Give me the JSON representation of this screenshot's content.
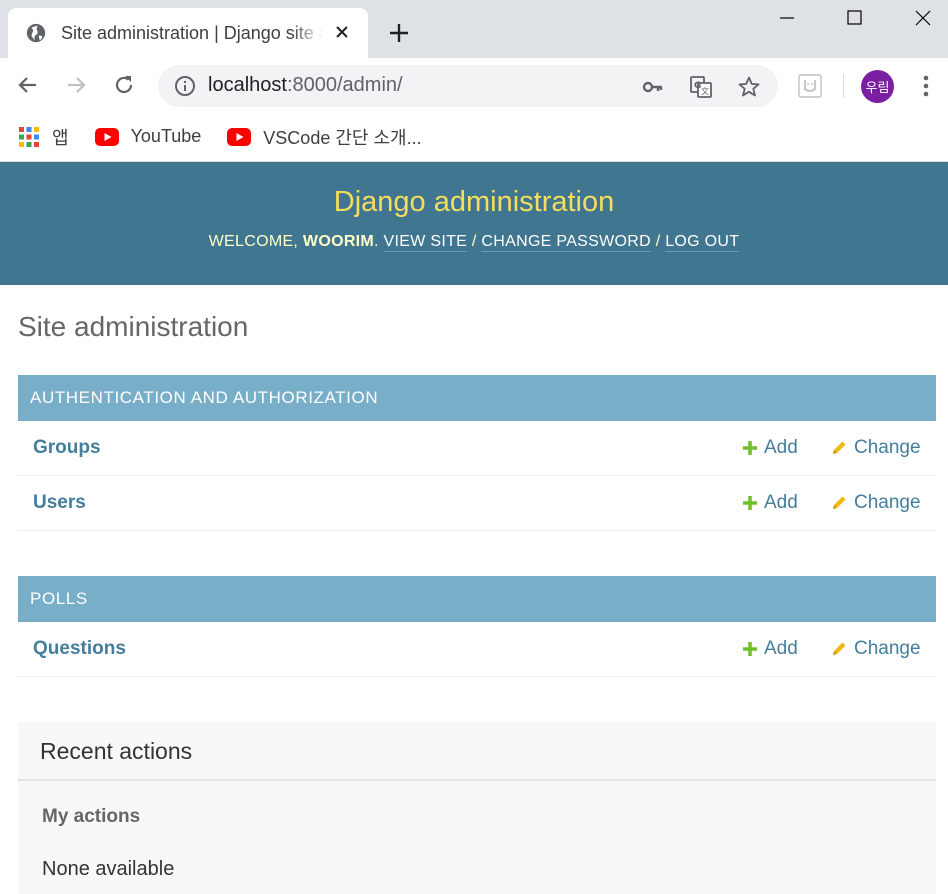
{
  "browser": {
    "tab_title": "Site administration | Django site admin",
    "url_host": "localhost",
    "url_path": ":8000/admin/",
    "profile_initials": "우림",
    "bookmarks": [
      {
        "label": "앱",
        "icon": "apps-grid-icon"
      },
      {
        "label": "YouTube",
        "icon": "youtube-icon"
      },
      {
        "label": "VSCode 간단 소개...",
        "icon": "youtube-icon"
      }
    ]
  },
  "header": {
    "brand": "Django administration",
    "welcome": "WELCOME, ",
    "username": "WOORIM",
    "period": ". ",
    "view_site": "VIEW SITE",
    "slash1": " / ",
    "change_password": "CHANGE PASSWORD",
    "slash2": " / ",
    "log_out": "LOG OUT"
  },
  "page_title": "Site administration",
  "modules": [
    {
      "caption": "AUTHENTICATION AND AUTHORIZATION",
      "models": [
        {
          "name": "Groups",
          "add": "Add",
          "change": "Change"
        },
        {
          "name": "Users",
          "add": "Add",
          "change": "Change"
        }
      ]
    },
    {
      "caption": "POLLS",
      "models": [
        {
          "name": "Questions",
          "add": "Add",
          "change": "Change"
        }
      ]
    }
  ],
  "recent": {
    "title": "Recent actions",
    "subtitle": "My actions",
    "empty": "None available"
  },
  "colors": {
    "header_bg": "#417690",
    "brand": "#f5dd5d",
    "caption_bg": "#79aec8",
    "link": "#447e9b",
    "add_icon": "#70bf2b",
    "change_icon": "#efb80b"
  }
}
